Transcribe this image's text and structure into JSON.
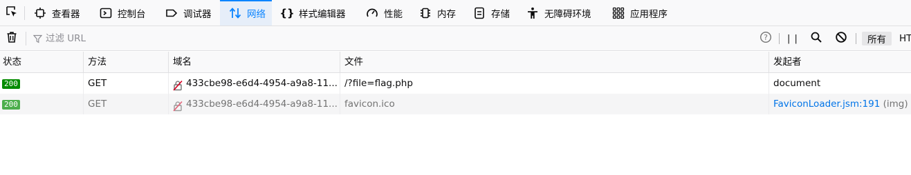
{
  "tabs": [
    {
      "label": "查看器",
      "icon": "inspector-icon",
      "selected": false
    },
    {
      "label": "控制台",
      "icon": "console-icon",
      "selected": false
    },
    {
      "label": "调试器",
      "icon": "debugger-icon",
      "selected": false
    },
    {
      "label": "网络",
      "icon": "network-arrows-icon",
      "selected": true
    },
    {
      "label": "样式编辑器",
      "icon": "style-editor-icon",
      "selected": false
    },
    {
      "label": "性能",
      "icon": "performance-icon",
      "selected": false
    },
    {
      "label": "内存",
      "icon": "memory-icon",
      "selected": false
    },
    {
      "label": "存储",
      "icon": "storage-icon",
      "selected": false
    },
    {
      "label": "无障碍环境",
      "icon": "accessibility-icon",
      "selected": false
    },
    {
      "label": "应用程序",
      "icon": "application-grid-icon",
      "selected": false
    }
  ],
  "toolbar": {
    "filter_placeholder": "过滤 URL",
    "filter_value": "",
    "pause_label": "| |",
    "all_label": "所有",
    "more_label": "HT"
  },
  "columns": {
    "status": "状态",
    "method": "方法",
    "domain": "域名",
    "file": "文件",
    "initiator": "发起者"
  },
  "requests": [
    {
      "status": "200",
      "method": "GET",
      "domain": "433cbe98-e6d4-4954-a9a8-11...",
      "file": "/?file=flag.php",
      "initiator": "document",
      "initiator_link": "",
      "initiator_note": ""
    },
    {
      "status": "200",
      "method": "GET",
      "domain": "433cbe98-e6d4-4954-a9a8-11...",
      "file": "favicon.ico",
      "initiator": "",
      "initiator_link": "FaviconLoader.jsm:191",
      "initiator_note": "(img)"
    }
  ],
  "colors": {
    "accent": "#0a84ff",
    "status_ok": "#058b00",
    "status_ok_faded": "#4cae4c",
    "link": "#0074e8"
  }
}
